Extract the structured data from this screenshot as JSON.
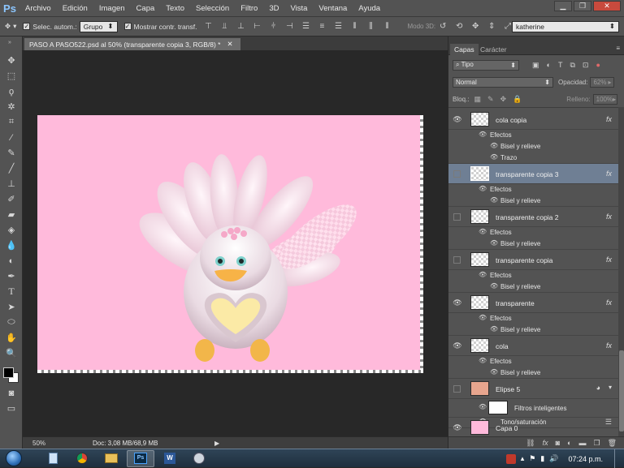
{
  "app": {
    "logo": "Ps",
    "menu": [
      "Archivo",
      "Edición",
      "Imagen",
      "Capa",
      "Texto",
      "Selección",
      "Filtro",
      "3D",
      "Vista",
      "Ventana",
      "Ayuda"
    ]
  },
  "options_bar": {
    "auto_select_label": "Selec. autom.:",
    "auto_select_value": "Grupo",
    "transform_label": "Mostrar contr. transf.",
    "mode3d_label": "Modo 3D:",
    "workspace_value": "katherine"
  },
  "document": {
    "tab_title": "PASO A PASO522.psd al 50% (transparente copia 3, RGB/8) *",
    "zoom": "50%",
    "doc_info": "Doc: 3,08 MB/68,9 MB",
    "canvas_color": "#ffbadb"
  },
  "panel": {
    "tabs": [
      "Capas",
      "Carácter"
    ],
    "filter_label": "Tipo",
    "blend_mode": "Normal",
    "opacity_label": "Opacidad:",
    "opacity_value": "62%",
    "lock_label": "Bloq.:",
    "fill_label": "Relleno:",
    "fill_value": "100%"
  },
  "layers": [
    {
      "name": "cola copia",
      "visible": true,
      "fx": "fx",
      "effects_label": "Efectos",
      "effects": [
        "Bisel y relieve",
        "Trazo"
      ]
    },
    {
      "name": "transparente copia 3",
      "visible": false,
      "selected": true,
      "fx": "fx",
      "effects_label": "Efectos",
      "effects": [
        "Bisel y relieve"
      ]
    },
    {
      "name": "transparente copia 2",
      "visible": false,
      "fx": "fx",
      "effects_label": "Efectos",
      "effects": [
        "Bisel y relieve"
      ]
    },
    {
      "name": "transparente copia",
      "visible": false,
      "fx": "fx",
      "effects_label": "Efectos",
      "effects": [
        "Bisel y relieve"
      ]
    },
    {
      "name": "transparente",
      "visible": true,
      "fx": "fx",
      "effects_label": "Efectos",
      "effects": [
        "Bisel y relieve"
      ]
    },
    {
      "name": "cola",
      "visible": true,
      "fx": "fx",
      "effects_label": "Efectos",
      "effects": [
        "Bisel y relieve"
      ]
    },
    {
      "name": "Elipse 5",
      "visible": false,
      "filters_label": "Filtros inteligentes",
      "filters": [
        "Tono/saturación"
      ]
    },
    {
      "name": "Capa 0",
      "visible": true
    }
  ],
  "taskbar": {
    "time": "07:24 p.m."
  }
}
